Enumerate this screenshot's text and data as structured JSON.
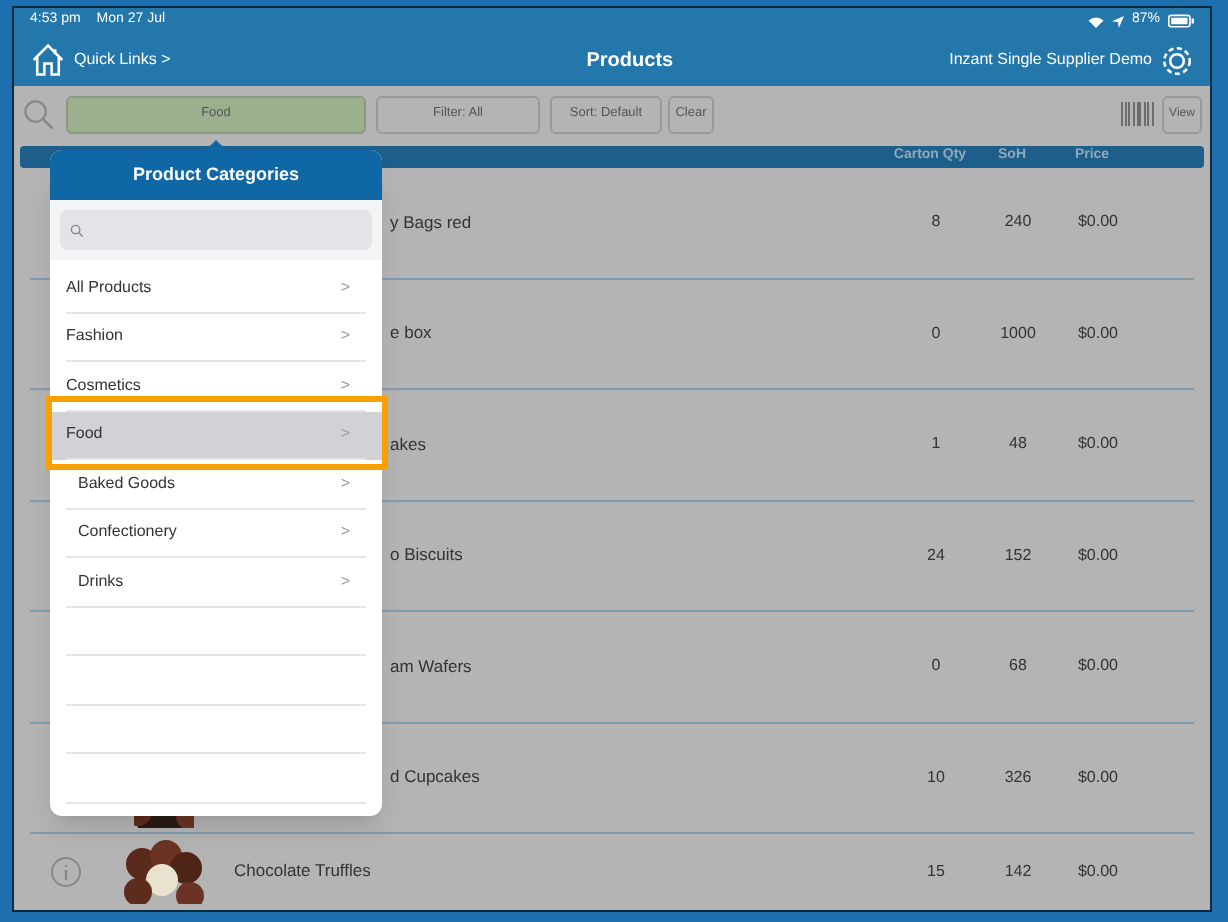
{
  "status_bar": {
    "time": "4:53 pm",
    "date": "Mon 27 Jul",
    "battery": "87%"
  },
  "nav": {
    "quick_links": "Quick Links >",
    "title": "Products",
    "account": "Inzant Single Supplier Demo"
  },
  "toolbar": {
    "category": "Food",
    "filter": "Filter: All",
    "sort": "Sort: Default",
    "clear": "Clear",
    "view": "View"
  },
  "table": {
    "columns": [
      "Carton Qty",
      "SoH",
      "Price"
    ],
    "rows": [
      {
        "kind": "covered",
        "name": "y Bags red",
        "carton_qty": "8",
        "soh": "240",
        "price": "$0.00"
      },
      {
        "kind": "covered",
        "name": "e box",
        "carton_qty": "0",
        "soh": "1000",
        "price": "$0.00"
      },
      {
        "kind": "covered",
        "name": "akes",
        "carton_qty": "1",
        "soh": "48",
        "price": "$0.00"
      },
      {
        "kind": "covered",
        "name": "o Biscuits",
        "carton_qty": "24",
        "soh": "152",
        "price": "$0.00"
      },
      {
        "kind": "covered",
        "name": "am Wafers",
        "carton_qty": "0",
        "soh": "68",
        "price": "$0.00"
      },
      {
        "kind": "covered-picture",
        "name": "d Cupcakes",
        "carton_qty": "10",
        "soh": "326",
        "price": "$0.00"
      },
      {
        "kind": "full",
        "name": "Chocolate Truffles",
        "carton_qty": "15",
        "soh": "142",
        "price": "$0.00"
      }
    ]
  },
  "popover": {
    "title": "Product Categories",
    "items": [
      {
        "label": "All Products",
        "chevron": ">",
        "selected": false
      },
      {
        "label": "Fashion",
        "chevron": ">",
        "selected": false
      },
      {
        "label": "Cosmetics",
        "chevron": ">",
        "selected": false
      },
      {
        "label": "Food",
        "chevron": ">",
        "selected": true,
        "children": [
          {
            "label": "Baked Goods",
            "chevron": ">",
            "selected": false
          },
          {
            "label": "Confectionery",
            "chevron": ">",
            "selected": false
          },
          {
            "label": "Drinks",
            "chevron": ">",
            "selected": false
          }
        ]
      }
    ]
  }
}
